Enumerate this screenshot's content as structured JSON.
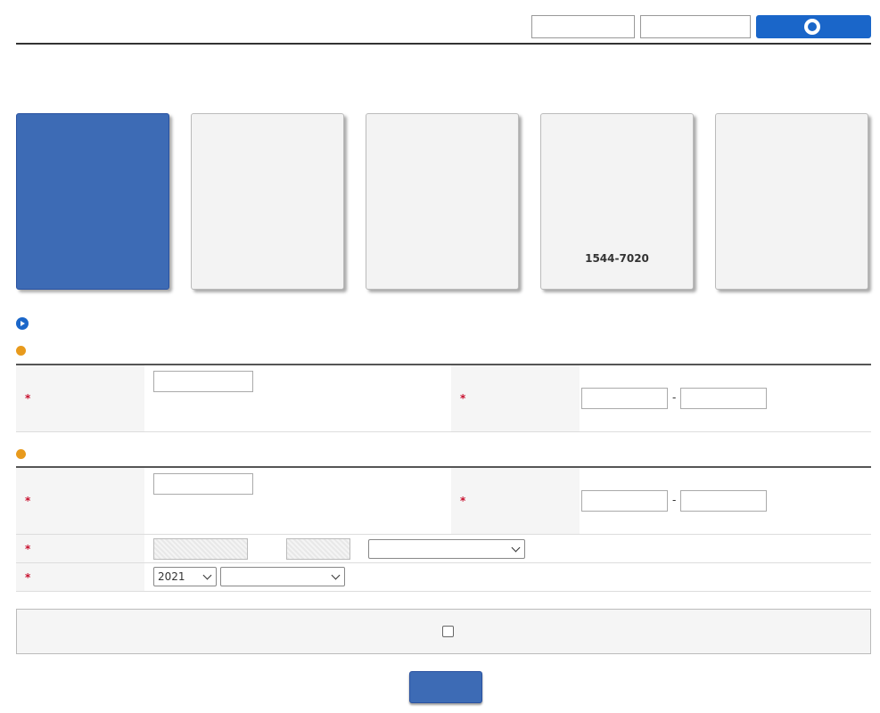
{
  "header": {
    "title": "",
    "buttons": {
      "simple_query": "",
      "consent_status": "",
      "chatbot": ""
    }
  },
  "intro": {
    "line1": "",
    "line2": ""
  },
  "cards": [
    {
      "title": "",
      "body": "",
      "sub_title": "",
      "sub_body": ""
    },
    {
      "title": "",
      "body": "",
      "sub_title": "",
      "sub_body": ""
    },
    {
      "title": "",
      "body": "",
      "sub_title": "",
      "sub_body": ""
    },
    {
      "title": "",
      "body": "",
      "fax": "",
      "fax_number": "1544-7020"
    },
    {
      "title": "",
      "body": "",
      "sub_title": "",
      "sub_body": ""
    }
  ],
  "auth_section": {
    "title": ""
  },
  "inquirer": {
    "title": "",
    "name_label": "",
    "name_hint": "",
    "rrn_label": "",
    "rrn_separator": "-"
  },
  "provider": {
    "title": "",
    "name_label": "",
    "name_hint": "",
    "rrn_label": "",
    "rrn_separator": "-",
    "relation_label": "",
    "relation_is": "",
    "relation_of": "",
    "relation_select": "",
    "relation_end": "",
    "scope_label": "",
    "scope_year": "2021",
    "scope_select": ""
  },
  "consent": {
    "text": "",
    "checked": false
  },
  "submit": {
    "label": ""
  },
  "colors": {
    "accent": "#1a66c9",
    "card_active": "#3d6bb5",
    "required": "#c8102e",
    "sub_icon": "#e89a1c"
  }
}
